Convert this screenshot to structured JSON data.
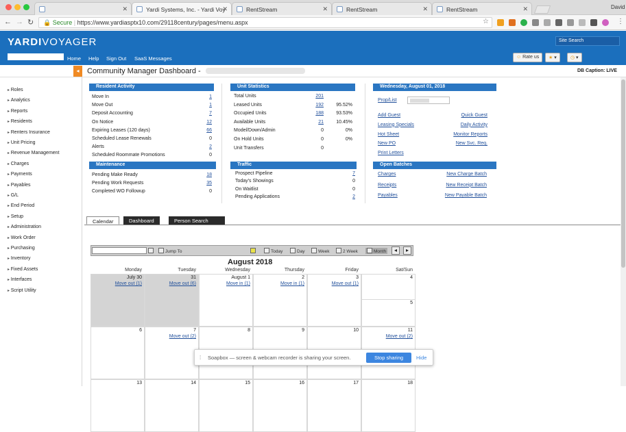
{
  "browser": {
    "tabs": [
      {
        "label": ""
      },
      {
        "label": "Yardi Systems, Inc. - Yardi Voy"
      },
      {
        "label": "RentStream"
      },
      {
        "label": "RentStream"
      },
      {
        "label": "RentStream"
      }
    ],
    "user": "David",
    "secure_label": "Secure",
    "url": "https://www.yardiasptx10.com/29118century/pages/menu.aspx"
  },
  "header": {
    "logo_a": "YARDI",
    "logo_b": "VOYAGER",
    "site_search": "Site Search",
    "nav": [
      "Home",
      "Help",
      "Sign Out",
      "SaaS Messages"
    ],
    "rate_us": "Rate us",
    "star_icon": "★",
    "clock_icon": "◷"
  },
  "title_bar": {
    "title": "Community Manager Dashboard -",
    "db_caption": "DB Caption: LIVE"
  },
  "sidebar": [
    "Roles",
    "Analytics",
    "Reports",
    "Residents",
    "Renters Insurance",
    "Unit Pricing",
    "Revenue Management",
    "Charges",
    "Payments",
    "Payables",
    "G/L",
    "End Period",
    "Setup",
    "Administration",
    "Work Order",
    "Purchasing",
    "Inventory",
    "Fixed Assets",
    "Interfaces",
    "Script Utility"
  ],
  "resident_activity": {
    "title": "Resident Activity",
    "rows": [
      {
        "label": "Move In",
        "value": "1",
        "link": true
      },
      {
        "label": "Move Out",
        "value": "1",
        "link": true
      },
      {
        "label": "Deposit Accounting",
        "value": "7",
        "link": true
      },
      {
        "label": "On Notice",
        "value": "12",
        "link": true
      },
      {
        "label": "Expiring Leases (120 days)",
        "value": "66",
        "link": true
      },
      {
        "label": "Scheduled Lease Renewals",
        "value": "0",
        "link": false
      },
      {
        "label": "Alerts",
        "value": "2",
        "link": true
      },
      {
        "label": "Scheduled Roommate Promotions",
        "value": "0",
        "link": false
      }
    ]
  },
  "maintenance": {
    "title": "Maintenance",
    "rows": [
      {
        "label": "Pending Make Ready",
        "value": "18",
        "link": true
      },
      {
        "label": "Pending Work Requests",
        "value": "35",
        "link": true
      },
      {
        "label": "Completed WO Followup",
        "value": "0",
        "link": false
      }
    ]
  },
  "unit_statistics": {
    "title": "Unit Statistics",
    "rows": [
      {
        "label": "Total Units",
        "value": "201",
        "pct": "",
        "link": true
      },
      {
        "label": "Leased Units",
        "value": "192",
        "pct": "95.52%",
        "link": true
      },
      {
        "label": "Occupied Units",
        "value": "188",
        "pct": "93.53%",
        "link": true
      },
      {
        "label": "Available Units",
        "value": "21",
        "pct": "10.45%",
        "link": true
      },
      {
        "label": "Model/Down/Admin",
        "value": "0",
        "pct": "0%",
        "link": false
      },
      {
        "label": "On Hold Units",
        "value": "0",
        "pct": "0%",
        "link": false
      },
      {
        "label": "Unit Transfers",
        "value": "0",
        "pct": "",
        "link": false
      }
    ]
  },
  "traffic": {
    "title": "Traffic",
    "rows": [
      {
        "label": "Prospect Pipeline",
        "value": "7",
        "link": true
      },
      {
        "label": "Today's Showings",
        "value": "0",
        "link": false
      },
      {
        "label": "On Waitlist",
        "value": "0",
        "link": false
      },
      {
        "label": "Pending Applications",
        "value": "2",
        "link": true
      }
    ]
  },
  "date_panel": {
    "title": "Wednesday, August 01, 2018",
    "prop_list": "Prop/List",
    "links_left": [
      "Add Guest",
      "Leasing Specials",
      "Hot Sheet",
      "New PO",
      "Print Letters"
    ],
    "links_right": [
      "Quick Guest",
      "Daily Activity",
      "Monitor Reports",
      "New Svc. Req."
    ]
  },
  "open_batches": {
    "title": "Open Batches",
    "links_left": [
      "Charges",
      "Receipts",
      "Payables"
    ],
    "links_right": [
      "New Charge Batch",
      "New Receipt Batch",
      "New Payable Batch"
    ]
  },
  "content_tabs": [
    "Calendar",
    "Dashboard",
    "Person Search"
  ],
  "calendar": {
    "jump_to": "Jump To",
    "views": [
      "Today",
      "Day",
      "Week",
      "2 Week",
      "Month"
    ],
    "month_title": "August 2018",
    "days_of_week": [
      "Monday",
      "Tuesday",
      "Wednesday",
      "Thursday",
      "Friday",
      "Sat/Sun"
    ],
    "weeks": [
      [
        {
          "day": "July 30",
          "event": "Move out (1)",
          "past": true
        },
        {
          "day": "31",
          "event": "Move out (6)",
          "past": true
        },
        {
          "day": "August 1",
          "event": "Move in (1)",
          "past": false
        },
        {
          "day": "2",
          "event": "Move in (1)",
          "past": false
        },
        {
          "day": "3",
          "event": "Move out (1)",
          "past": false
        },
        {
          "day": "4",
          "event": "",
          "past": false,
          "day2": "5"
        }
      ],
      [
        {
          "day": "6",
          "event": "",
          "past": false
        },
        {
          "day": "7",
          "event": "Move out (2)",
          "past": false
        },
        {
          "day": "8",
          "event": "",
          "past": false
        },
        {
          "day": "9",
          "event": "",
          "past": false
        },
        {
          "day": "10",
          "event": "",
          "past": false
        },
        {
          "day": "11",
          "event": "Move out (2)",
          "past": false
        }
      ],
      [
        {
          "day": "13",
          "event": "",
          "past": false
        },
        {
          "day": "14",
          "event": "",
          "past": false
        },
        {
          "day": "15",
          "event": "",
          "past": false
        },
        {
          "day": "16",
          "event": "",
          "past": false
        },
        {
          "day": "17",
          "event": "",
          "past": false
        },
        {
          "day": "18",
          "event": "",
          "past": false
        }
      ]
    ]
  },
  "soapbox": {
    "message": "Soapbox — screen & webcam recorder is sharing your screen.",
    "stop": "Stop sharing",
    "hide": "Hide"
  }
}
